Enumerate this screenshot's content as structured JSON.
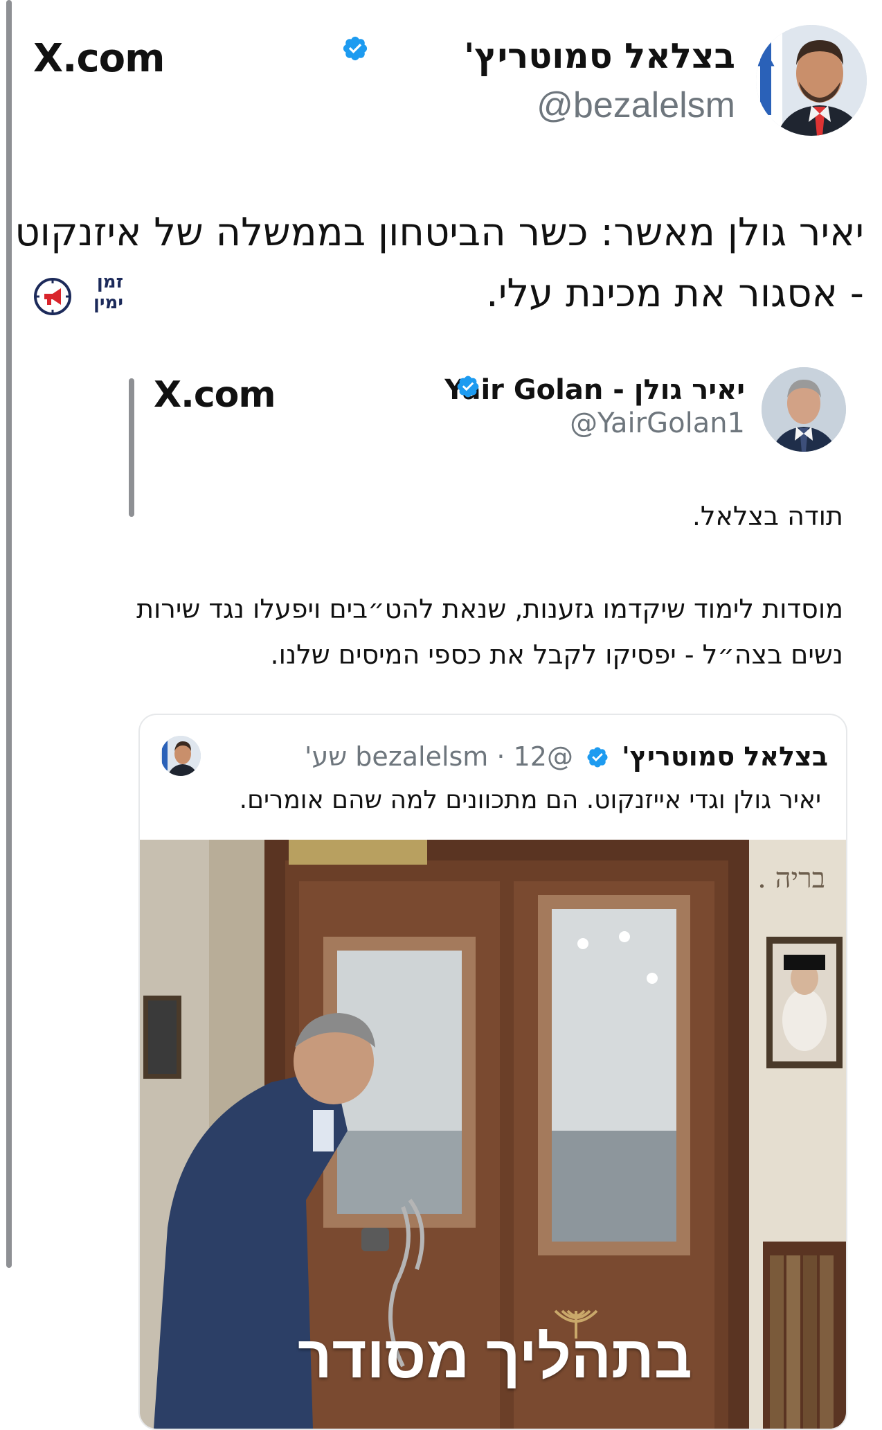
{
  "outer_post": {
    "source_logo": "X.com",
    "author_name": "בצלאל סמוטריץ'",
    "author_handle": "@bezalelsm",
    "text": "יאיר גולן מאשר: כשר הביטחון בממשלה של איזנקוט - אסגור את מכינת עלי."
  },
  "brand_badge": {
    "text": "זמן ימין",
    "icon": "megaphone-icon",
    "color": "#1c2a5a",
    "accent": "#d9242b"
  },
  "inner_post": {
    "source_logo": "X.com",
    "author_name": "יאיר גולן - Yair Golan",
    "author_handle": "@YairGolan1",
    "text_line_1": "תודה בצלאל.",
    "text_line_2": "מוסדות לימוד שיקדמו גזענות, שנאת להט״בים ויפעלו נגד שירות נשים בצה״ל - יפסיקו לקבל את כספי המיסים שלנו."
  },
  "quoted_card": {
    "author_name": "בצלאל סמוטריץ'",
    "author_handle": "@bezalelsm",
    "time": "12 שע'",
    "text": "יאיר גולן וגדי אייזנקוט. הם מתכוונים למה שהם אומרים.",
    "media_caption": "בתהליך מסודר",
    "media_sign": "בריה ."
  },
  "colors": {
    "verified_blue": "#1d9bf0",
    "handle_gray": "#6e767d",
    "thread_line": "#8e9094"
  }
}
